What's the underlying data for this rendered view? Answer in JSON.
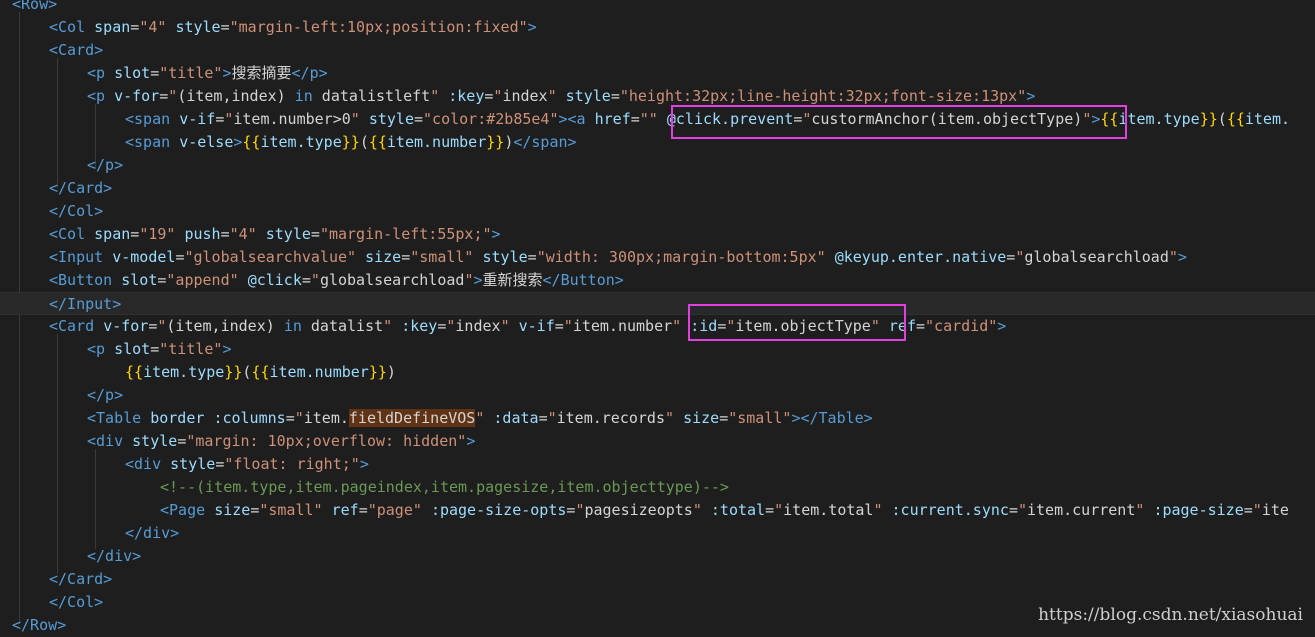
{
  "editor": {
    "lines": [
      {
        "segs": [
          [
            "t",
            "<Row>"
          ]
        ]
      },
      {
        "segs": [
          [
            "t",
            "<Col "
          ],
          [
            "a",
            "span"
          ],
          [
            "x",
            "="
          ],
          [
            "s",
            "\"4\""
          ],
          [
            "x",
            " "
          ],
          [
            "a",
            "style"
          ],
          [
            "x",
            "="
          ],
          [
            "s",
            "\"margin-left:10px;position:fixed\""
          ],
          [
            "t",
            ">"
          ]
        ]
      },
      {
        "segs": [
          [
            "t",
            "<Card>"
          ]
        ]
      },
      {
        "segs": [
          [
            "t",
            "<p "
          ],
          [
            "a",
            "slot"
          ],
          [
            "x",
            "="
          ],
          [
            "s",
            "\"title\""
          ],
          [
            "t",
            ">"
          ],
          [
            "x",
            "搜索摘要"
          ],
          [
            "t",
            "</p>"
          ]
        ]
      },
      {
        "segs": [
          [
            "t",
            "<p "
          ],
          [
            "a",
            "v-for"
          ],
          [
            "x",
            "="
          ],
          [
            "s",
            "\""
          ],
          [
            "x",
            "(item,index) "
          ],
          [
            "t",
            "in"
          ],
          [
            "x",
            " datalistleft"
          ],
          [
            "s",
            "\""
          ],
          [
            "x",
            " "
          ],
          [
            "a",
            ":key"
          ],
          [
            "x",
            "="
          ],
          [
            "s",
            "\""
          ],
          [
            "x",
            "index"
          ],
          [
            "s",
            "\""
          ],
          [
            "x",
            " "
          ],
          [
            "a",
            "style"
          ],
          [
            "x",
            "="
          ],
          [
            "s",
            "\"height:32px;line-height:32px;font-size:13px\""
          ],
          [
            "t",
            ">"
          ]
        ]
      },
      {
        "segs": [
          [
            "t",
            "<span "
          ],
          [
            "a",
            "v-if"
          ],
          [
            "x",
            "="
          ],
          [
            "s",
            "\""
          ],
          [
            "x",
            "item.number>0"
          ],
          [
            "s",
            "\""
          ],
          [
            "x",
            " "
          ],
          [
            "a",
            "style"
          ],
          [
            "x",
            "="
          ],
          [
            "s",
            "\"color:#2b85e4\""
          ],
          [
            "t",
            ">"
          ],
          [
            "t",
            "<a "
          ],
          [
            "a",
            "href"
          ],
          [
            "x",
            "="
          ],
          [
            "s",
            "\"\""
          ],
          [
            "x",
            " "
          ],
          [
            "a",
            "@click.prevent"
          ],
          [
            "x",
            "="
          ],
          [
            "s",
            "\""
          ],
          [
            "x",
            "custormAnchor(item.objectType)"
          ],
          [
            "s",
            "\""
          ],
          [
            "t",
            ">"
          ],
          [
            "m",
            "{{"
          ],
          [
            "i",
            "item.type"
          ],
          [
            "m",
            "}}"
          ],
          [
            "x",
            "("
          ],
          [
            "m",
            "{{"
          ],
          [
            "i",
            "item."
          ]
        ]
      },
      {
        "segs": [
          [
            "t",
            "<span "
          ],
          [
            "a",
            "v-else"
          ],
          [
            "t",
            ">"
          ],
          [
            "m",
            "{{"
          ],
          [
            "i",
            "item.type"
          ],
          [
            "m",
            "}}"
          ],
          [
            "x",
            "("
          ],
          [
            "m",
            "{{"
          ],
          [
            "i",
            "item.number"
          ],
          [
            "m",
            "}}"
          ],
          [
            "x",
            ")"
          ],
          [
            "t",
            "</span>"
          ]
        ]
      },
      {
        "segs": [
          [
            "t",
            "</p>"
          ]
        ]
      },
      {
        "segs": [
          [
            "t",
            "</Card>"
          ]
        ]
      },
      {
        "segs": [
          [
            "t",
            "</Col>"
          ]
        ]
      },
      {
        "segs": [
          [
            "t",
            "<Col "
          ],
          [
            "a",
            "span"
          ],
          [
            "x",
            "="
          ],
          [
            "s",
            "\"19\""
          ],
          [
            "x",
            " "
          ],
          [
            "a",
            "push"
          ],
          [
            "x",
            "="
          ],
          [
            "s",
            "\"4\""
          ],
          [
            "x",
            " "
          ],
          [
            "a",
            "style"
          ],
          [
            "x",
            "="
          ],
          [
            "s",
            "\"margin-left:55px;\""
          ],
          [
            "t",
            ">"
          ]
        ]
      },
      {
        "segs": [
          [
            "t",
            "<Input "
          ],
          [
            "a",
            "v-model"
          ],
          [
            "x",
            "="
          ],
          [
            "s",
            "\"globalsearchvalue\""
          ],
          [
            "x",
            " "
          ],
          [
            "a",
            "size"
          ],
          [
            "x",
            "="
          ],
          [
            "s",
            "\"small\""
          ],
          [
            "x",
            " "
          ],
          [
            "a",
            "style"
          ],
          [
            "x",
            "="
          ],
          [
            "s",
            "\"width: 300px;margin-bottom:5px\""
          ],
          [
            "x",
            " "
          ],
          [
            "a",
            "@keyup.enter.native"
          ],
          [
            "x",
            "="
          ],
          [
            "s",
            "\""
          ],
          [
            "x",
            "globalsearchload"
          ],
          [
            "s",
            "\""
          ],
          [
            "t",
            ">"
          ]
        ]
      },
      {
        "segs": [
          [
            "t",
            "<Button "
          ],
          [
            "a",
            "slot"
          ],
          [
            "x",
            "="
          ],
          [
            "s",
            "\"append\""
          ],
          [
            "x",
            " "
          ],
          [
            "a",
            "@click"
          ],
          [
            "x",
            "="
          ],
          [
            "s",
            "\""
          ],
          [
            "x",
            "globalsearchload"
          ],
          [
            "s",
            "\""
          ],
          [
            "t",
            ">"
          ],
          [
            "x",
            "重新搜索"
          ],
          [
            "t",
            "</Button>"
          ]
        ]
      },
      {
        "segs": [
          [
            "t",
            "</Input>"
          ]
        ]
      },
      {
        "segs": [
          [
            "t",
            "<Card "
          ],
          [
            "a",
            "v-for"
          ],
          [
            "x",
            "="
          ],
          [
            "s",
            "\""
          ],
          [
            "x",
            "(item,index) "
          ],
          [
            "t",
            "in"
          ],
          [
            "x",
            " datalist"
          ],
          [
            "s",
            "\""
          ],
          [
            "x",
            " "
          ],
          [
            "a",
            ":key"
          ],
          [
            "x",
            "="
          ],
          [
            "s",
            "\""
          ],
          [
            "x",
            "index"
          ],
          [
            "s",
            "\""
          ],
          [
            "x",
            " "
          ],
          [
            "a",
            "v-if"
          ],
          [
            "x",
            "="
          ],
          [
            "s",
            "\""
          ],
          [
            "x",
            "item.number"
          ],
          [
            "s",
            "\""
          ],
          [
            "x",
            " "
          ],
          [
            "a",
            ":id"
          ],
          [
            "x",
            "="
          ],
          [
            "s",
            "\""
          ],
          [
            "x",
            "item.objectType"
          ],
          [
            "s",
            "\""
          ],
          [
            "x",
            " "
          ],
          [
            "a",
            "ref"
          ],
          [
            "x",
            "="
          ],
          [
            "s",
            "\"cardid\""
          ],
          [
            "t",
            ">"
          ]
        ]
      },
      {
        "segs": [
          [
            "t",
            "<p "
          ],
          [
            "a",
            "slot"
          ],
          [
            "x",
            "="
          ],
          [
            "s",
            "\"title\""
          ],
          [
            "t",
            ">"
          ]
        ]
      },
      {
        "segs": [
          [
            "m",
            "{{"
          ],
          [
            "i",
            "item.type"
          ],
          [
            "m",
            "}}"
          ],
          [
            "x",
            "("
          ],
          [
            "m",
            "{{"
          ],
          [
            "i",
            "item.number"
          ],
          [
            "m",
            "}}"
          ],
          [
            "x",
            ")"
          ]
        ]
      },
      {
        "segs": [
          [
            "t",
            "</p>"
          ]
        ]
      },
      {
        "segs": [
          [
            "t",
            "<Table "
          ],
          [
            "a",
            "border"
          ],
          [
            "x",
            " "
          ],
          [
            "a",
            ":columns"
          ],
          [
            "x",
            "="
          ],
          [
            "s",
            "\""
          ],
          [
            "x",
            "item."
          ],
          [
            "hl",
            "fieldDefineVOS"
          ],
          [
            "s",
            "\""
          ],
          [
            "x",
            " "
          ],
          [
            "a",
            ":data"
          ],
          [
            "x",
            "="
          ],
          [
            "s",
            "\""
          ],
          [
            "x",
            "item.records"
          ],
          [
            "s",
            "\""
          ],
          [
            "x",
            " "
          ],
          [
            "a",
            "size"
          ],
          [
            "x",
            "="
          ],
          [
            "s",
            "\"small\""
          ],
          [
            "t",
            "></Table>"
          ]
        ]
      },
      {
        "segs": [
          [
            "t",
            "<div "
          ],
          [
            "a",
            "style"
          ],
          [
            "x",
            "="
          ],
          [
            "s",
            "\"margin: 10px;overflow: hidden\""
          ],
          [
            "t",
            ">"
          ]
        ]
      },
      {
        "segs": [
          [
            "t",
            "<div "
          ],
          [
            "a",
            "style"
          ],
          [
            "x",
            "="
          ],
          [
            "s",
            "\"float: right;\""
          ],
          [
            "t",
            ">"
          ]
        ]
      },
      {
        "segs": [
          [
            "c",
            "<!--(item.type,item.pageindex,item.pagesize,item.objecttype)-->"
          ]
        ]
      },
      {
        "segs": [
          [
            "t",
            "<Page "
          ],
          [
            "a",
            "size"
          ],
          [
            "x",
            "="
          ],
          [
            "s",
            "\"small\""
          ],
          [
            "x",
            " "
          ],
          [
            "a",
            "ref"
          ],
          [
            "x",
            "="
          ],
          [
            "s",
            "\"page\""
          ],
          [
            "x",
            " "
          ],
          [
            "a",
            ":page-size-opts"
          ],
          [
            "x",
            "="
          ],
          [
            "s",
            "\""
          ],
          [
            "x",
            "pagesizeopts"
          ],
          [
            "s",
            "\""
          ],
          [
            "x",
            " "
          ],
          [
            "a",
            ":total"
          ],
          [
            "x",
            "="
          ],
          [
            "s",
            "\""
          ],
          [
            "x",
            "item.total"
          ],
          [
            "s",
            "\""
          ],
          [
            "x",
            " "
          ],
          [
            "a",
            ":current.sync"
          ],
          [
            "x",
            "="
          ],
          [
            "s",
            "\""
          ],
          [
            "x",
            "item.current"
          ],
          [
            "s",
            "\""
          ],
          [
            "x",
            " "
          ],
          [
            "a",
            ":page-size"
          ],
          [
            "x",
            "="
          ],
          [
            "s",
            "\""
          ],
          [
            "x",
            "ite"
          ]
        ]
      },
      {
        "segs": [
          [
            "t",
            "</div>"
          ]
        ]
      },
      {
        "segs": [
          [
            "t",
            "</div>"
          ]
        ]
      },
      {
        "segs": [
          [
            "t",
            "</Card>"
          ]
        ]
      },
      {
        "segs": [
          [
            "t",
            "</Col>"
          ]
        ]
      },
      {
        "segs": [
          [
            "t",
            "</Row>"
          ]
        ]
      }
    ]
  },
  "watermark": "https://blog.csdn.net/xiasohuai"
}
